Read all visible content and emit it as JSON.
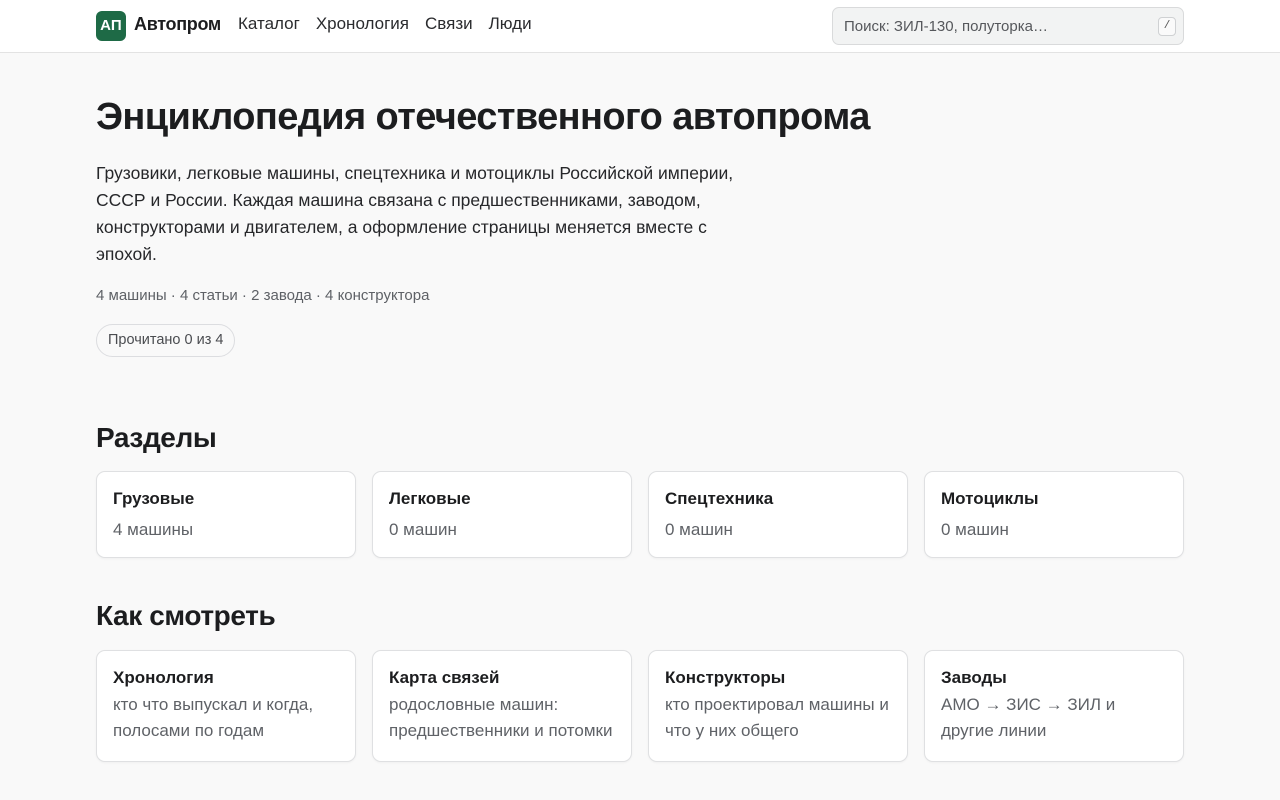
{
  "header": {
    "logo_mark": "АП",
    "logo_text": "Автопром",
    "nav": [
      "Каталог",
      "Хронология",
      "Связи",
      "Люди"
    ],
    "search_placeholder": "Поиск: ЗИЛ-130, полуторка…",
    "search_shortcut": "/"
  },
  "hero": {
    "title": "Энциклопедия отечественного автопрома",
    "lead": "Грузовики, легковые машины, спецтехника и мотоциклы Российской империи, СССР и России. Каждая машина связана с предшественниками, заводом, конструкторами и двигателем, а оформление страницы меняется вместе с эпохой.",
    "stats": "4 машины · 4 статьи · 2 завода · 4 конструктора",
    "progress": "Прочитано 0 из 4"
  },
  "sections": {
    "title": "Разделы",
    "cards": [
      {
        "title": "Грузовые",
        "subtitle": "4 машины"
      },
      {
        "title": "Легковые",
        "subtitle": "0 машин"
      },
      {
        "title": "Спецтехника",
        "subtitle": "0 машин"
      },
      {
        "title": "Мотоциклы",
        "subtitle": "0 машин"
      }
    ]
  },
  "views": {
    "title": "Как смотреть",
    "cards": [
      {
        "title": "Хронология",
        "subtitle": "кто что выпускал и когда, полосами по годам"
      },
      {
        "title": "Карта связей",
        "subtitle": "родословные машин: предшественники и потомки"
      },
      {
        "title": "Конструкторы",
        "subtitle": "кто проектировал машины и что у них общего"
      },
      {
        "title": "Заводы",
        "subtitle": "АМО → ЗИС → ЗИЛ и другие линии"
      }
    ]
  },
  "colors": {
    "brand": "#1e6a46",
    "background": "#f9f9f9",
    "card": "#ffffff"
  }
}
